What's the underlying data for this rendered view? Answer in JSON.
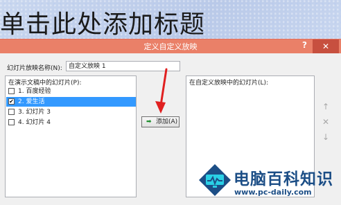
{
  "slide": {
    "title": "单击此处添加标题"
  },
  "dialog": {
    "title": "定义自定义放映",
    "help": "?",
    "close": "✕",
    "name_label": "幻灯片放映名称(N):",
    "name_value": "自定义放映 1",
    "left_label": "在演示文稿中的幻灯片(P):",
    "right_label": "在自定义放映中的幻灯片(L):",
    "slides": [
      {
        "label": "1. 百度经验",
        "checked": false,
        "selected": false
      },
      {
        "label": "2. 爱生活",
        "checked": true,
        "selected": true
      },
      {
        "label": "3. 幻灯片 3",
        "checked": false,
        "selected": false
      },
      {
        "label": "4. 幻灯片 4",
        "checked": false,
        "selected": false
      }
    ],
    "add_button": "添加(A)",
    "add_icon": "double-arrow-right-icon",
    "side_buttons": [
      "↑",
      "✕",
      "↓"
    ]
  },
  "watermark": {
    "text": "电脑百科知识",
    "url": "www.pc-daily.com"
  },
  "colors": {
    "titlebar": "#ea8068",
    "selection": "#3399ff",
    "annotation_arrow": "#e02020",
    "brand": "#1c4e86"
  }
}
